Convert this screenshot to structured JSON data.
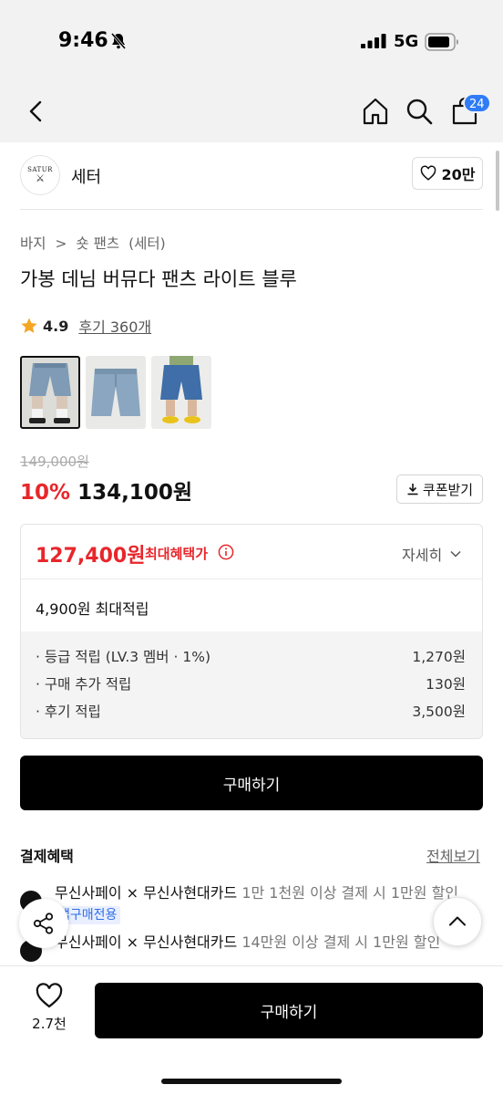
{
  "status_bar": {
    "time": "9:46",
    "network": "5G"
  },
  "header": {
    "cart_count": "24",
    "icons": [
      "back-icon",
      "home-icon",
      "search-icon",
      "cart-icon"
    ]
  },
  "brand": {
    "logo_text": "SATUR",
    "logo_mark": "⚔",
    "name": "세터",
    "like_count": "20만"
  },
  "breadcrumb": [
    "바지",
    ">",
    "숏 팬츠",
    "(세터)"
  ],
  "product": {
    "title": "가봉 데님 버뮤다 팬츠 라이트 블루",
    "rating": "4.9",
    "review_link": "후기 360개",
    "original_price": "149,000원",
    "discount_rate": "10%",
    "sale_price": "134,100원",
    "coupon_label": "쿠폰받기"
  },
  "benefit": {
    "max_price": "127,400원",
    "max_label": "최대혜택가",
    "detail_label": "자세히",
    "points_total": "4,900원 최대적립",
    "points": [
      {
        "label": "· 등급 적립 (LV.3 멤버 · 1%)",
        "value": "1,270원"
      },
      {
        "label": "· 구매 추가 적립",
        "value": "130원"
      },
      {
        "label": "· 후기 적립",
        "value": "3,500원"
      }
    ]
  },
  "buy_label": "구매하기",
  "payment": {
    "title": "결제혜택",
    "view_all": "전체보기",
    "items": [
      {
        "main": "무신사페이 × 무신사현대카드",
        "sub": "1만 1천원 이상 결제 시 1만원 할인",
        "tag": "앱구매전용"
      },
      {
        "main": "무신사페이 × 무신사현대카드",
        "sub": "14만원 이상 결제 시 1만원 할인",
        "tag": ""
      }
    ]
  },
  "bottom_bar": {
    "wish_count": "2.7천",
    "buy_label": "구매하기"
  },
  "colors": {
    "accent_red": "#e8262b",
    "badge_blue": "#2f7cf6",
    "button_black": "#000000"
  }
}
